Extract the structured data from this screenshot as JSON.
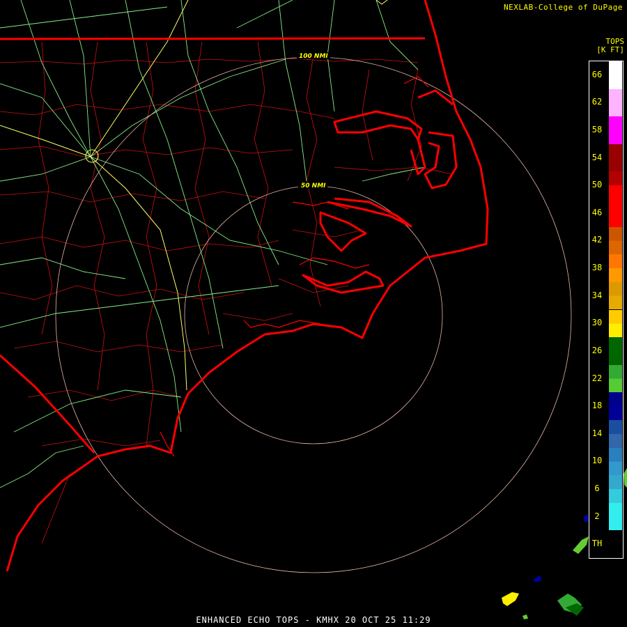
{
  "header": {
    "attribution": "NEXLAB-College of DuPage"
  },
  "legend": {
    "title_line1": "TOPS",
    "title_line2": "[K FT]",
    "entries": [
      {
        "label": "66",
        "colors": [
          "#ffffff",
          "#ffffff"
        ]
      },
      {
        "label": "62",
        "colors": [
          "#ffb3ff",
          "#ffb3ff"
        ]
      },
      {
        "label": "58",
        "colors": [
          "#ff00ff",
          "#ff00ff"
        ]
      },
      {
        "label": "54",
        "colors": [
          "#990000",
          "#990000"
        ]
      },
      {
        "label": "50",
        "colors": [
          "#b30000",
          "#ff0000"
        ]
      },
      {
        "label": "46",
        "colors": [
          "#ff0000",
          "#ff0000"
        ]
      },
      {
        "label": "42",
        "colors": [
          "#cc5500",
          "#dd6600"
        ]
      },
      {
        "label": "38",
        "colors": [
          "#ff7700",
          "#ff9900"
        ]
      },
      {
        "label": "34",
        "colors": [
          "#dd9900",
          "#e6aa00"
        ]
      },
      {
        "label": "30",
        "colors": [
          "#ffcc00",
          "#ffee00"
        ]
      },
      {
        "label": "26",
        "colors": [
          "#006600",
          "#006600"
        ]
      },
      {
        "label": "22",
        "colors": [
          "#33aa33",
          "#55cc33"
        ]
      },
      {
        "label": "18",
        "colors": [
          "#00008b",
          "#000099"
        ]
      },
      {
        "label": "14",
        "colors": [
          "#1a4fa0",
          "#3366aa"
        ]
      },
      {
        "label": "10",
        "colors": [
          "#2a7fbf",
          "#3399cc"
        ]
      },
      {
        "label": "6",
        "colors": [
          "#33aacc",
          "#33ccdd"
        ]
      },
      {
        "label": "2",
        "colors": [
          "#33eeee",
          "#33eeee"
        ]
      },
      {
        "label": "TH",
        "colors": [
          "#000000",
          "#000000"
        ]
      }
    ]
  },
  "rings": [
    {
      "label": "50 NMI"
    },
    {
      "label": "100 NMI"
    }
  ],
  "footer": {
    "text": "ENHANCED ECHO TOPS - KMHX 20 OCT 25 11:29"
  },
  "colors": {
    "state_border": "#ff0000",
    "county": "#cc1111",
    "highway": "#88ee88",
    "interstate": "#ffff66",
    "ring": "#e8b8a8"
  }
}
